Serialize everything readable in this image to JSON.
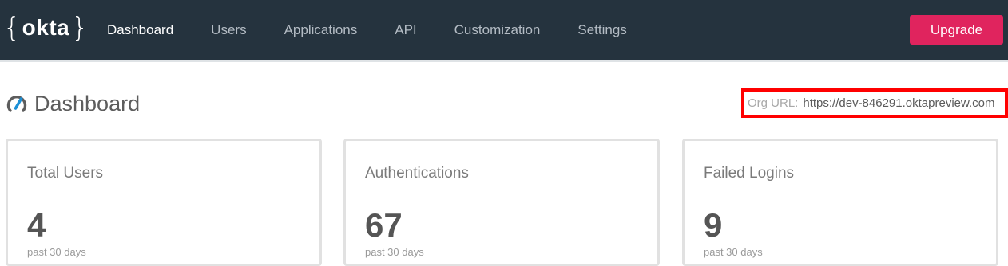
{
  "header": {
    "logo_text": "okta",
    "nav": [
      {
        "label": "Dashboard",
        "active": true
      },
      {
        "label": "Users",
        "active": false
      },
      {
        "label": "Applications",
        "active": false
      },
      {
        "label": "API",
        "active": false
      },
      {
        "label": "Customization",
        "active": false
      },
      {
        "label": "Settings",
        "active": false
      }
    ],
    "upgrade_label": "Upgrade"
  },
  "page": {
    "title": "Dashboard",
    "org_url_label": "Org URL:",
    "org_url_value": "https://dev-846291.oktapreview.com"
  },
  "cards": [
    {
      "title": "Total Users",
      "value": "4",
      "sub": "past 30 days"
    },
    {
      "title": "Authentications",
      "value": "67",
      "sub": "past 30 days"
    },
    {
      "title": "Failed Logins",
      "value": "9",
      "sub": "past 30 days"
    }
  ],
  "colors": {
    "topbar": "#25333e",
    "accent": "#e0245e",
    "highlight_box": "#ff0000",
    "gauge_blue": "#1b8fd6"
  }
}
